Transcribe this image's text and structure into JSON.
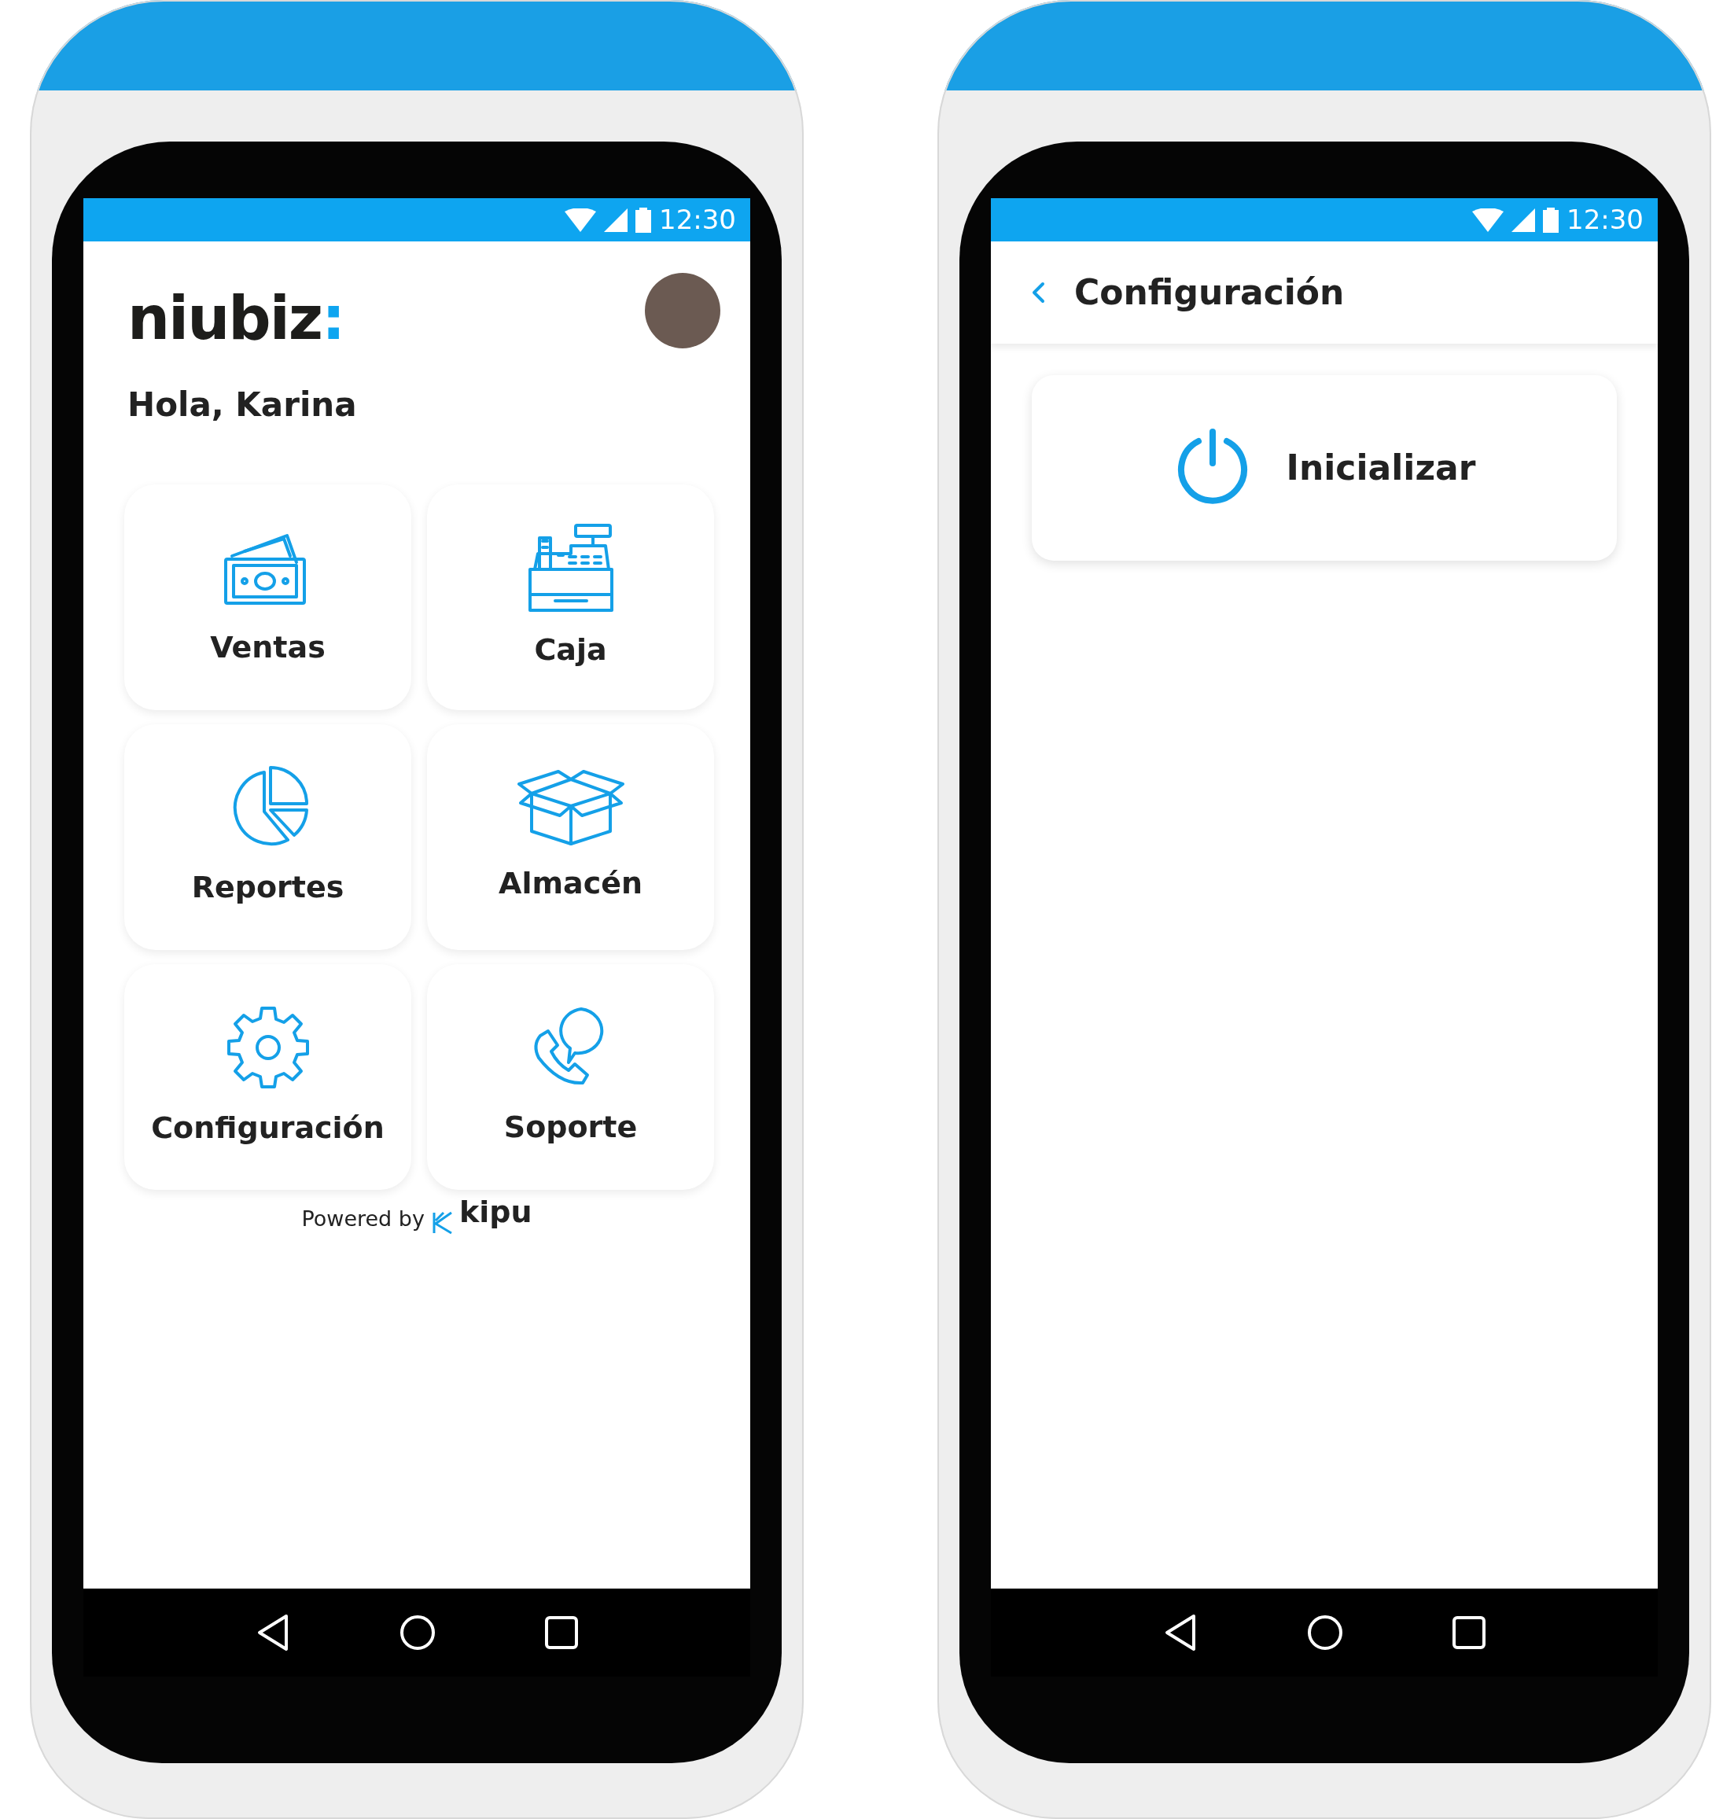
{
  "screens": [
    {
      "kind": "home",
      "status_bar": {
        "time": "12:30"
      },
      "logo": {
        "text": "niubiz",
        "mark": ":"
      },
      "greeting": "Hola, Karina",
      "tiles": [
        {
          "label": "Ventas",
          "kind": "cash"
        },
        {
          "label": "Caja",
          "kind": "register"
        },
        {
          "label": "Reportes",
          "kind": "pie"
        },
        {
          "label": "Almacén",
          "kind": "box"
        },
        {
          "label": "Configuración",
          "kind": "gear"
        },
        {
          "label": "Soporte",
          "kind": "support"
        }
      ],
      "footer": {
        "prefix": "Powered by",
        "brand": "kipu"
      }
    },
    {
      "kind": "settings",
      "status_bar": {
        "time": "12:30"
      },
      "header": {
        "title": "Configuración"
      },
      "actions": [
        {
          "label": "Inicializar",
          "kind": "power"
        }
      ]
    }
  ]
}
